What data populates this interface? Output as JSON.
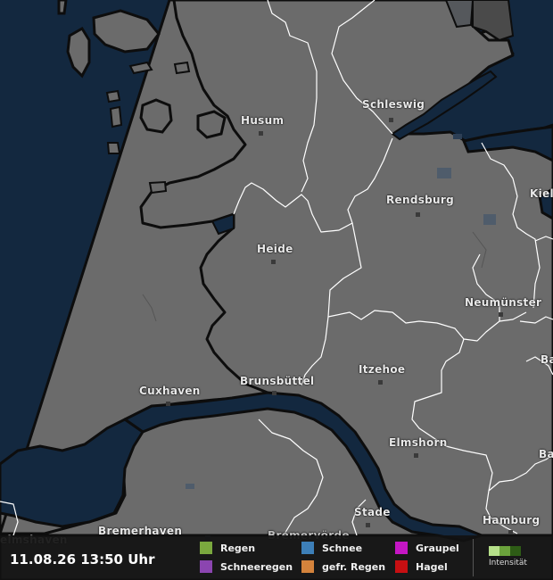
{
  "map": {
    "cities": [
      {
        "id": "husum",
        "name": "Husum"
      },
      {
        "id": "schleswig",
        "name": "Schleswig"
      },
      {
        "id": "kiel",
        "name": "Kiel"
      },
      {
        "id": "rendsburg",
        "name": "Rendsburg"
      },
      {
        "id": "heide",
        "name": "Heide"
      },
      {
        "id": "neumuenster",
        "name": "Neumünster"
      },
      {
        "id": "itzehoe",
        "name": "Itzehoe"
      },
      {
        "id": "brunsbuettel",
        "name": "Brunsbüttel"
      },
      {
        "id": "cuxhaven",
        "name": "Cuxhaven"
      },
      {
        "id": "elmshorn",
        "name": "Elmshorn"
      },
      {
        "id": "stade",
        "name": "Stade"
      },
      {
        "id": "hamburg",
        "name": "Hamburg"
      },
      {
        "id": "bremerhaven",
        "name": "Bremerhaven"
      },
      {
        "id": "bremervoerde",
        "name": "Bremervörde"
      },
      {
        "id": "wilhelmshaven",
        "name": "elmshaven"
      },
      {
        "id": "bad-seg",
        "name": "Ba"
      },
      {
        "id": "bar",
        "name": "Ba"
      }
    ]
  },
  "legend": {
    "timestamp": "11.08.26 13:50 Uhr",
    "items": [
      {
        "id": "regen",
        "label": "Regen",
        "color": "#7aa83e"
      },
      {
        "id": "schnee",
        "label": "Schnee",
        "color": "#3d7fb8"
      },
      {
        "id": "graupel",
        "label": "Graupel",
        "color": "#c416c4"
      },
      {
        "id": "schneeregen",
        "label": "Schneeregen",
        "color": "#8b45b0"
      },
      {
        "id": "gefr-regen",
        "label": "gefr. Regen",
        "color": "#d4833c"
      },
      {
        "id": "hagel",
        "label": "Hagel",
        "color": "#c80f12"
      }
    ],
    "intensity_label": "Intensität",
    "intensity_colors": [
      "#b6e08a",
      "#6ba33c",
      "#2e5c16"
    ]
  },
  "colors": {
    "sea": "#13283f",
    "land": "#6b6b6b",
    "border": "#ffffff",
    "coast": "#0d0d0d"
  }
}
